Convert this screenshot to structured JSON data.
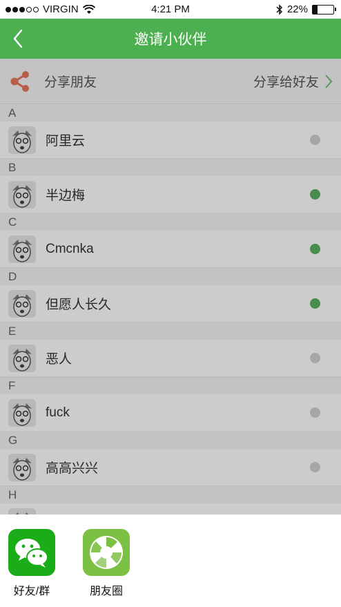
{
  "status_bar": {
    "carrier": "VIRGIN",
    "time": "4:21 PM",
    "battery": "22%",
    "battery_level": 0.22
  },
  "navbar": {
    "title": "邀请小伙伴",
    "back_icon": "chevron-left-icon"
  },
  "share_row": {
    "label": "分享朋友",
    "action": "分享给好友",
    "icon": "share-icon"
  },
  "sections": [
    {
      "letter": "A",
      "contacts": [
        {
          "name": "阿里云",
          "online": false
        }
      ]
    },
    {
      "letter": "B",
      "contacts": [
        {
          "name": "半边梅",
          "online": true
        }
      ]
    },
    {
      "letter": "C",
      "contacts": [
        {
          "name": "Cmcnka",
          "online": true
        }
      ]
    },
    {
      "letter": "D",
      "contacts": [
        {
          "name": "但愿人长久",
          "online": true
        }
      ]
    },
    {
      "letter": "E",
      "contacts": [
        {
          "name": "恶人",
          "online": false
        }
      ]
    },
    {
      "letter": "F",
      "contacts": [
        {
          "name": "fuck",
          "online": false
        }
      ]
    },
    {
      "letter": "G",
      "contacts": [
        {
          "name": "高高兴兴",
          "online": false
        }
      ]
    },
    {
      "letter": "H",
      "contacts": []
    }
  ],
  "share_sheet": {
    "items": [
      {
        "label": "好友/群",
        "icon": "wechat-icon",
        "color": "#1aad19"
      },
      {
        "label": "朋友圈",
        "icon": "moments-icon",
        "color": "#7bc043"
      }
    ]
  },
  "colors": {
    "primary": "#4caf50",
    "online": "#5cae5f",
    "offline": "#d0d0d0",
    "share_accent": "#e8755a"
  }
}
